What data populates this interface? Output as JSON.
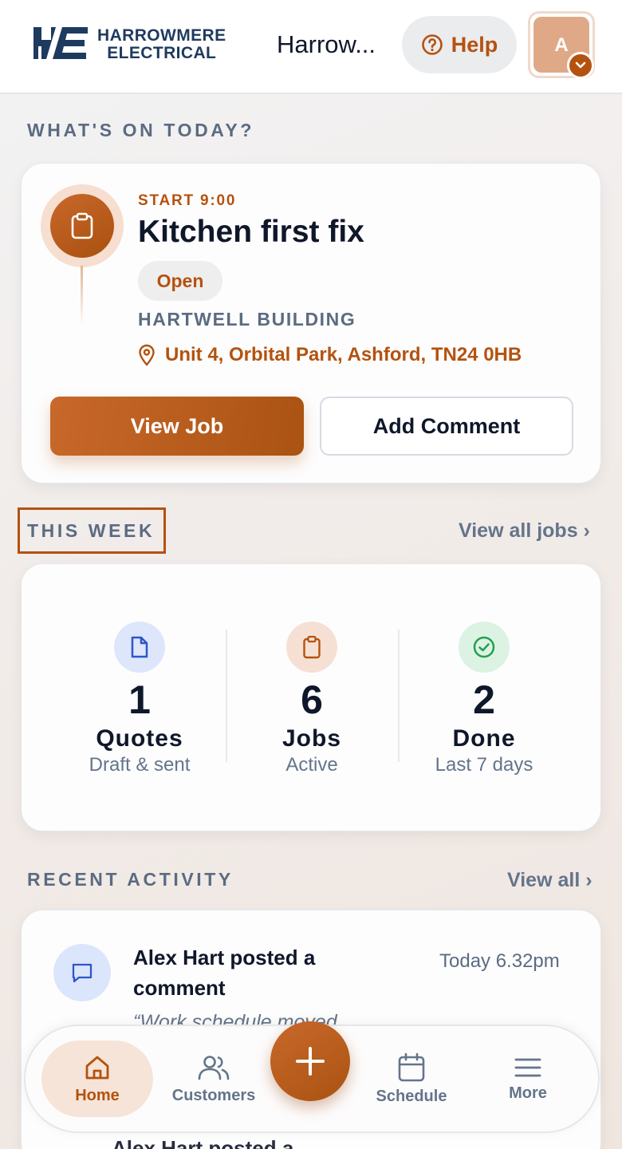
{
  "header": {
    "logo_line1": "HARROWMERE",
    "logo_line2": "ELECTRICAL",
    "company_name": "Harrow...",
    "help_label": "Help",
    "avatar_initial": "A"
  },
  "today": {
    "section_title": "WHAT'S ON TODAY?",
    "start_label": "START 9:00",
    "job_title": "Kitchen first fix",
    "status": "Open",
    "customer": "HARTWELL BUILDING",
    "address": "Unit 4, Orbital Park, Ashford, TN24 0HB",
    "view_job_label": "View Job",
    "add_comment_label": "Add Comment"
  },
  "week": {
    "section_title": "THIS WEEK",
    "link_label": "View all jobs ›",
    "stats": [
      {
        "value": "1",
        "label": "Quotes",
        "sub": "Draft & sent",
        "icon": "document-icon"
      },
      {
        "value": "6",
        "label": "Jobs",
        "sub": "Active",
        "icon": "clipboard-icon"
      },
      {
        "value": "2",
        "label": "Done",
        "sub": "Last 7 days",
        "icon": "check-circle-icon"
      }
    ]
  },
  "activity": {
    "section_title": "RECENT ACTIVITY",
    "link_label": "View all ›",
    "items": [
      {
        "text": "Alex Hart posted a comment",
        "time": "Today 6.32pm",
        "quote": "“Work schedule moved"
      },
      {
        "text": "Alex Hart posted a"
      }
    ]
  },
  "nav": {
    "items": [
      {
        "label": "Home",
        "icon": "home-icon"
      },
      {
        "label": "Customers",
        "icon": "users-icon"
      },
      {
        "label": "Schedule",
        "icon": "calendar-icon"
      },
      {
        "label": "More",
        "icon": "menu-icon"
      }
    ],
    "fab_icon": "plus-icon"
  },
  "colors": {
    "accent": "#b4520f",
    "navy": "#1e3a5f",
    "muted": "#64748b"
  }
}
